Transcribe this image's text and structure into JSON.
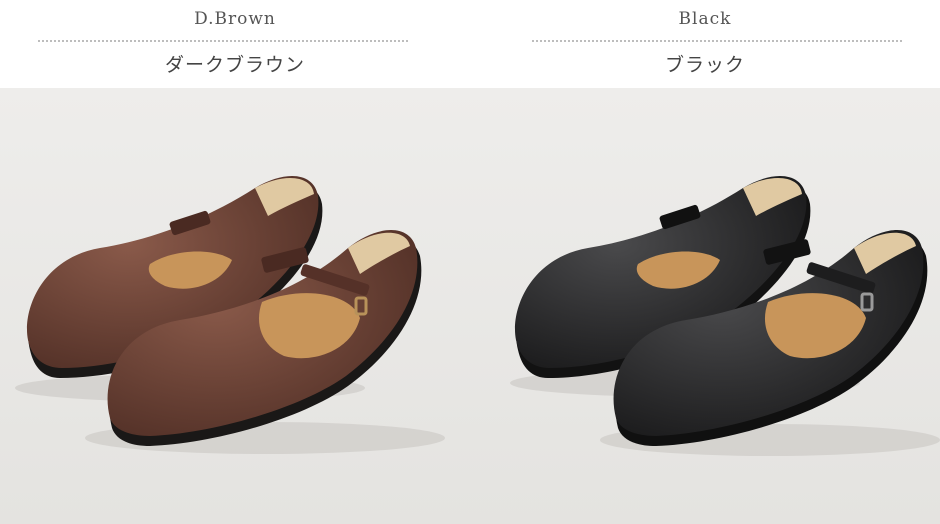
{
  "variants": [
    {
      "name_en": "D.Brown",
      "name_jp": "ダークブラウン",
      "upper_color": "#5a342a",
      "upper_highlight": "#8a5a4a",
      "insole_color": "#c8955a",
      "lining_color": "#e0c9a2",
      "sole_color": "#1c1a19",
      "icon": "brown-tbar-shoes-photo"
    },
    {
      "name_en": "Black",
      "name_jp": "ブラック",
      "upper_color": "#1c1c1d",
      "upper_highlight": "#4a4a4c",
      "insole_color": "#c8955a",
      "lining_color": "#e0c9a2",
      "sole_color": "#141414",
      "icon": "black-tbar-shoes-photo"
    }
  ],
  "background_color": "#e9e8e6"
}
